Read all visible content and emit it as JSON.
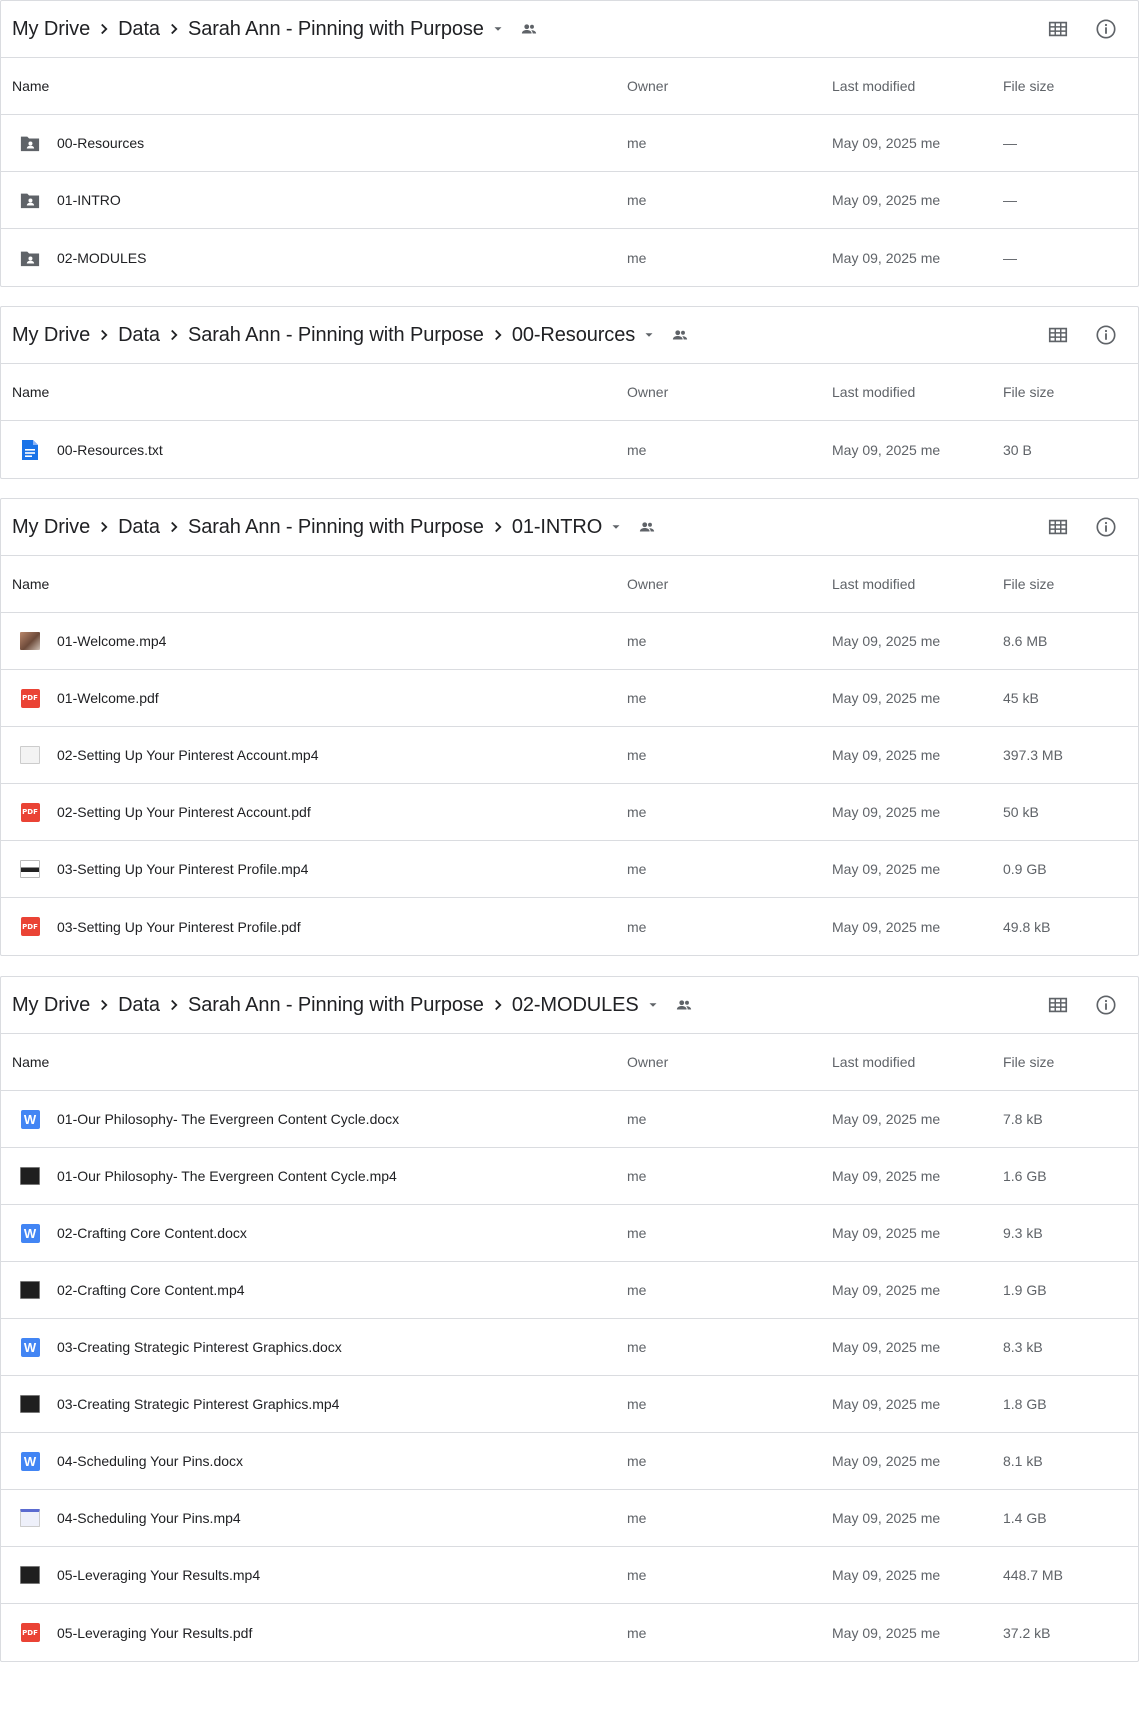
{
  "columns": {
    "name": "Name",
    "owner": "Owner",
    "modified": "Last modified",
    "size": "File size"
  },
  "colors": {
    "border": "#dadce0",
    "pdf": "#ea4335",
    "word": "#4285f4",
    "doc": "#1a73e8",
    "folder": "#5f6368"
  },
  "panels": [
    {
      "breadcrumb": [
        "My Drive",
        "Data",
        "Sarah Ann - Pinning with Purpose"
      ],
      "rows": [
        {
          "icon": "shared-folder-icon",
          "name": "00-Resources",
          "owner": "me",
          "modified": "May 09, 2025 me",
          "size": "—"
        },
        {
          "icon": "shared-folder-icon",
          "name": "01-INTRO",
          "owner": "me",
          "modified": "May 09, 2025 me",
          "size": "—"
        },
        {
          "icon": "shared-folder-icon",
          "name": "02-MODULES",
          "owner": "me",
          "modified": "May 09, 2025 me",
          "size": "—"
        }
      ]
    },
    {
      "breadcrumb": [
        "My Drive",
        "Data",
        "Sarah Ann - Pinning with Purpose",
        "00-Resources"
      ],
      "rows": [
        {
          "icon": "text-doc-icon",
          "name": "00-Resources.txt",
          "owner": "me",
          "modified": "May 09, 2025 me",
          "size": "30 B"
        }
      ]
    },
    {
      "breadcrumb": [
        "My Drive",
        "Data",
        "Sarah Ann - Pinning with Purpose",
        "01-INTRO"
      ],
      "rows": [
        {
          "icon": "video-thumbnail-photo-icon",
          "name": "01-Welcome.mp4",
          "owner": "me",
          "modified": "May 09, 2025 me",
          "size": "8.6 MB"
        },
        {
          "icon": "pdf-icon",
          "name": "01-Welcome.pdf",
          "owner": "me",
          "modified": "May 09, 2025 me",
          "size": "45 kB"
        },
        {
          "icon": "video-thumbnail-light-icon",
          "name": "02-Setting Up Your Pinterest Account.mp4",
          "owner": "me",
          "modified": "May 09, 2025 me",
          "size": "397.3 MB"
        },
        {
          "icon": "pdf-icon",
          "name": "02-Setting Up Your Pinterest Account.pdf",
          "owner": "me",
          "modified": "May 09, 2025 me",
          "size": "50 kB"
        },
        {
          "icon": "video-thumbnail-mixed-icon",
          "name": "03-Setting Up Your Pinterest Profile.mp4",
          "owner": "me",
          "modified": "May 09, 2025 me",
          "size": "0.9 GB"
        },
        {
          "icon": "pdf-icon",
          "name": "03-Setting Up Your Pinterest Profile.pdf",
          "owner": "me",
          "modified": "May 09, 2025 me",
          "size": "49.8 kB"
        }
      ]
    },
    {
      "breadcrumb": [
        "My Drive",
        "Data",
        "Sarah Ann - Pinning with Purpose",
        "02-MODULES"
      ],
      "rows": [
        {
          "icon": "word-doc-icon",
          "name": "01-Our Philosophy- The Evergreen Content Cycle.docx",
          "owner": "me",
          "modified": "May 09, 2025 me",
          "size": "7.8 kB"
        },
        {
          "icon": "video-thumbnail-dark-icon",
          "name": "01-Our Philosophy- The Evergreen Content Cycle.mp4",
          "owner": "me",
          "modified": "May 09, 2025 me",
          "size": "1.6 GB"
        },
        {
          "icon": "word-doc-icon",
          "name": "02-Crafting Core Content.docx",
          "owner": "me",
          "modified": "May 09, 2025 me",
          "size": "9.3 kB"
        },
        {
          "icon": "video-thumbnail-dark-icon",
          "name": "02-Crafting Core Content.mp4",
          "owner": "me",
          "modified": "May 09, 2025 me",
          "size": "1.9 GB"
        },
        {
          "icon": "word-doc-icon",
          "name": "03-Creating Strategic Pinterest Graphics.docx",
          "owner": "me",
          "modified": "May 09, 2025 me",
          "size": "8.3 kB"
        },
        {
          "icon": "video-thumbnail-dark-icon",
          "name": "03-Creating Strategic Pinterest Graphics.mp4",
          "owner": "me",
          "modified": "May 09, 2025 me",
          "size": "1.8 GB"
        },
        {
          "icon": "word-doc-icon",
          "name": "04-Scheduling Your Pins.docx",
          "owner": "me",
          "modified": "May 09, 2025 me",
          "size": "8.1 kB"
        },
        {
          "icon": "video-thumbnail-blue-icon",
          "name": "04-Scheduling Your Pins.mp4",
          "owner": "me",
          "modified": "May 09, 2025 me",
          "size": "1.4 GB"
        },
        {
          "icon": "video-thumbnail-dark-icon",
          "name": "05-Leveraging Your Results.mp4",
          "owner": "me",
          "modified": "May 09, 2025 me",
          "size": "448.7 MB"
        },
        {
          "icon": "pdf-icon",
          "name": "05-Leveraging Your Results.pdf",
          "owner": "me",
          "modified": "May 09, 2025 me",
          "size": "37.2 kB"
        }
      ]
    }
  ]
}
